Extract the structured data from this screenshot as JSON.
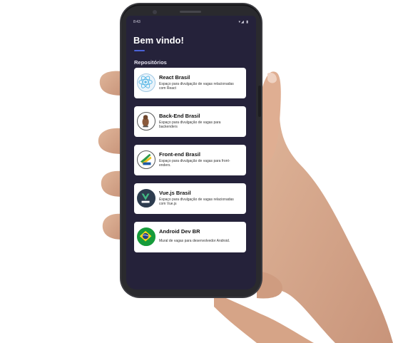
{
  "status_bar": {
    "time": "8:43",
    "icons": "▾◢ ▮",
    "icon_names": [
      "wifi-icon",
      "signal-icon",
      "battery-icon"
    ]
  },
  "header": {
    "title": "Bem vindo!",
    "accent": "#4b63d8"
  },
  "section": {
    "title": "Repositórios"
  },
  "repos": [
    {
      "name": "React Brasil",
      "description": "Espaço para divulgação de vagas relacionadas com React",
      "icon": "react-icon"
    },
    {
      "name": "Back-End Brasil",
      "description": "Espaço para divulgação de vagas para backenders",
      "icon": "backend-brasil-logo"
    },
    {
      "name": "Front-end Brasil",
      "description": "Espaço para divulgação de vagas para front-enders.",
      "icon": "frontend-brasil-logo"
    },
    {
      "name": "Vue.js Brasil",
      "description": "Espaço para divulgação de vagas relacionadas com Vue.js",
      "icon": "vuejs-brasil-logo"
    },
    {
      "name": "Android Dev BR",
      "description": "Mural de vagas para desenvolvedor Android.",
      "icon": "brazil-flag-icon"
    }
  ],
  "colors": {
    "screen_bg": "#25223a",
    "card_bg": "#ffffff",
    "phone_body": "#2a2a2e"
  }
}
